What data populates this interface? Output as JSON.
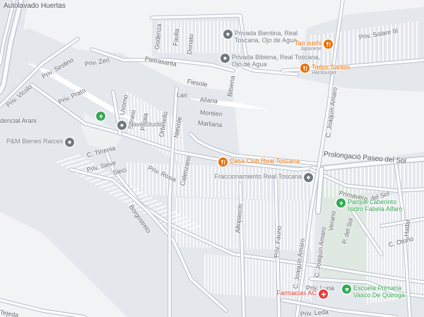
{
  "map": {
    "colors": {
      "background": "#f2f3f5",
      "road": "#c7ccd4",
      "road_major": "#b8c0cc",
      "block": "#e4e7ec",
      "park": "#cfe9d8",
      "accent_park": "#34a853",
      "accent_food": "#e8710a",
      "accent_health": "#e53935",
      "accent_place": "#707780"
    },
    "streets": [
      {
        "name": "Autolavado Huertas"
      },
      {
        "name": "Priv. Solare III"
      },
      {
        "name": "Godenza"
      },
      {
        "name": "Faulia"
      },
      {
        "name": "Donato"
      },
      {
        "name": "Pietrasanta"
      },
      {
        "name": "Priv. Zeri"
      },
      {
        "name": "Priv. Sestino"
      },
      {
        "name": "Priv. Vicolo"
      },
      {
        "name": "Priv. Prato"
      },
      {
        "name": "Fiesole"
      },
      {
        "name": "Bibiena"
      },
      {
        "name": "Lari"
      },
      {
        "name": "Aliana"
      },
      {
        "name": "Montieri"
      },
      {
        "name": "Marliana"
      },
      {
        "name": "Livorno"
      },
      {
        "name": "Senesi"
      },
      {
        "name": "Palaia"
      },
      {
        "name": "Orbetello"
      },
      {
        "name": "Nievole"
      },
      {
        "name": "Calenzano"
      },
      {
        "name": "C. Tirrenia"
      },
      {
        "name": "Priv. Sieve"
      },
      {
        "name": "Sieci"
      },
      {
        "name": "Priv. Rosia"
      },
      {
        "name": "Borgostreto"
      },
      {
        "name": "Altopascio"
      },
      {
        "name": "Priv. Fauno"
      },
      {
        "name": "C. Joaquín Amaro"
      },
      {
        "name": "C. Joaquín Amaro"
      },
      {
        "name": "C. Joaquín Amaro"
      },
      {
        "name": "Prolongació Paseo del Sol"
      },
      {
        "name": "Primavera"
      },
      {
        "name": "P. del Sol"
      },
      {
        "name": "Verano"
      },
      {
        "name": "P. del Sol"
      },
      {
        "name": "Hadar"
      },
      {
        "name": "C. Otoño"
      },
      {
        "name": "Priv. Luna"
      },
      {
        "name": "Priv. Leda"
      },
      {
        "name": "Tejeda"
      },
      {
        "name": "dencial Arani"
      }
    ],
    "pois": [
      {
        "name": "Privada Bientina, Real Toscana, Ojo de Agua",
        "sub": "",
        "type": "place",
        "icon": "pin-icon"
      },
      {
        "name": "Privada Bibiena, Real Toscana, Ojo de Agua",
        "sub": "",
        "type": "place",
        "icon": "pin-icon"
      },
      {
        "name": "Tao sushi",
        "sub": "Japanese",
        "type": "food",
        "icon": "fork-knife-icon"
      },
      {
        "name": "Todos Santos",
        "sub": "Hamburger",
        "type": "food",
        "icon": "fork-knife-icon"
      },
      {
        "name": "Nave Studio",
        "sub": "",
        "type": "place",
        "icon": "pin-icon"
      },
      {
        "name": "P&M Bienes Raíces",
        "sub": "",
        "type": "place",
        "icon": "pin-icon"
      },
      {
        "name": "",
        "sub": "",
        "type": "park",
        "icon": "tree-icon"
      },
      {
        "name": "Casa Club Real Toscana",
        "sub": "",
        "type": "food",
        "icon": "fork-knife-icon"
      },
      {
        "name": "Fraccionamiento Real Toscana",
        "sub": "",
        "type": "place",
        "icon": "pin-icon"
      },
      {
        "name": "Parque Laberinto Isidro Fabela Alfaro",
        "sub": "",
        "type": "park",
        "icon": "tree-icon"
      },
      {
        "name": "Escuela Primaria Vasco De Quiroga",
        "sub": "",
        "type": "school",
        "icon": "school-icon"
      },
      {
        "name": "Farmacias AC",
        "sub": "",
        "type": "health",
        "icon": "cross-icon"
      }
    ]
  }
}
